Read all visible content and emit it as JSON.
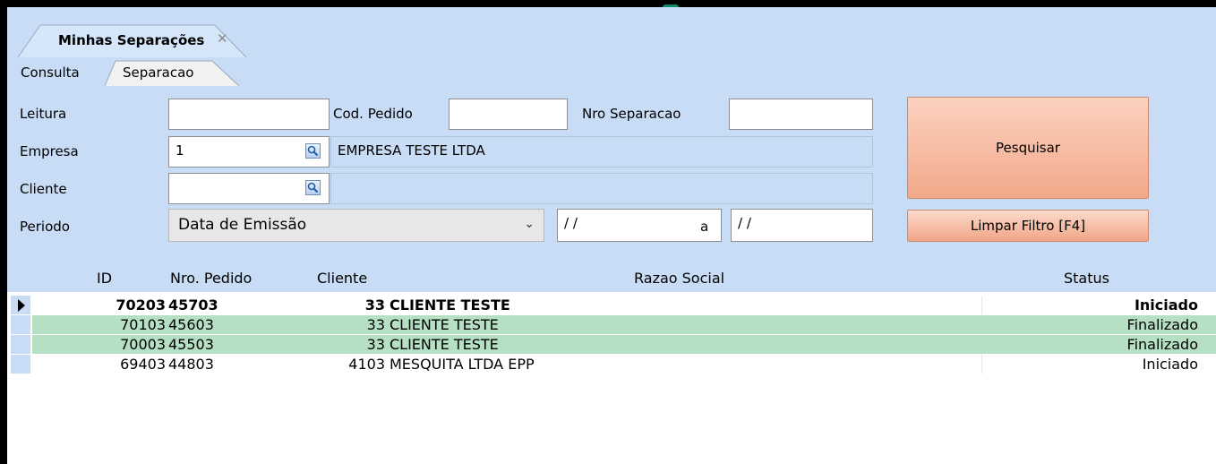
{
  "tabs": {
    "document_title": "Minhas Separações",
    "close_glyph": "✕",
    "consulta": "Consulta",
    "separacao": "Separacao"
  },
  "form": {
    "leitura_label": "Leitura",
    "leitura_value": "",
    "cod_pedido_label": "Cod. Pedido",
    "cod_pedido_value": "",
    "nro_separacao_label": "Nro Separacao",
    "nro_separacao_value": "",
    "empresa_label": "Empresa",
    "empresa_value": "1",
    "empresa_name": "EMPRESA TESTE LTDA",
    "cliente_label": "Cliente",
    "cliente_value": "",
    "cliente_name": "",
    "periodo_label": "Periodo",
    "periodo_selected": "Data de Emissão",
    "date_from": "/ /",
    "date_sep": "a",
    "date_to": "/ /"
  },
  "buttons": {
    "search": "Pesquisar",
    "clear": "Limpar Filtro [F4]"
  },
  "grid": {
    "headers": {
      "id": "ID",
      "pedido": "Nro. Pedido",
      "cliente": "Cliente",
      "razao": "Razao Social",
      "status": "Status"
    },
    "rows": [
      {
        "id": "70203",
        "pedido": "45703",
        "cliente": "33",
        "razao": "CLIENTE TESTE",
        "status": "Iniciado"
      },
      {
        "id": "70103",
        "pedido": "45603",
        "cliente": "33",
        "razao": "CLIENTE TESTE",
        "status": "Finalizado"
      },
      {
        "id": "70003",
        "pedido": "45503",
        "cliente": "33",
        "razao": "CLIENTE TESTE",
        "status": "Finalizado"
      },
      {
        "id": "69403",
        "pedido": "44803",
        "cliente": "4103",
        "razao": "MESQUITA LTDA EPP",
        "status": "Iniciado"
      }
    ]
  },
  "colors": {
    "panel_bg": "#c8dcf5",
    "finalizado_row": "#b6e0c4",
    "button_salmon": "#f3a88a"
  }
}
